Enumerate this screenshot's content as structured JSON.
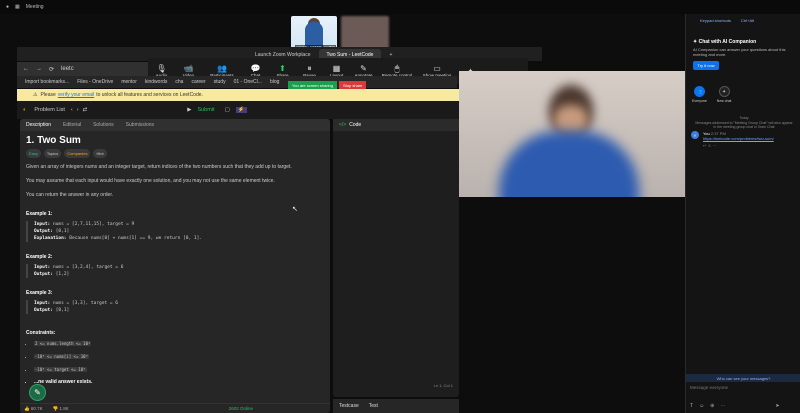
{
  "window": {
    "title": "Meeting"
  },
  "video_strip": {
    "thumb1_name": "AHMATH-JAMMIMI_ALOBJE"
  },
  "browser": {
    "tabs": [
      {
        "label": "Launch Zoom Workplace",
        "active": false
      },
      {
        "label": "Two Sum - LeetCode",
        "active": true
      },
      {
        "label": "+",
        "active": false
      }
    ],
    "address": "leetc",
    "bookmarks": [
      "Import bookmarks...",
      "Files - OneDrive",
      "mentor",
      "kindwords",
      "cha",
      "career",
      "study",
      "01 - OneCl...",
      "blog"
    ]
  },
  "zoom_toolbar": {
    "items": [
      {
        "label": "Audio",
        "icon": "🎙"
      },
      {
        "label": "Video",
        "icon": "📹"
      },
      {
        "label": "Participants",
        "icon": "👥"
      },
      {
        "label": "Chat",
        "icon": "💬"
      },
      {
        "label": "Share",
        "icon": "⬆"
      },
      {
        "label": "Pause",
        "icon": "⏸"
      },
      {
        "label": "Layout",
        "icon": "▦"
      },
      {
        "label": "Annotate",
        "icon": "✎"
      },
      {
        "label": "Remote control",
        "icon": "🖱"
      },
      {
        "label": "Show meeting",
        "icon": "▭"
      },
      {
        "label": "",
        "icon": "✦"
      },
      {
        "label": "",
        "icon": "⋯"
      }
    ],
    "sharing_status": "You are screen sharing",
    "stop_share": "Stop share"
  },
  "banner": {
    "prefix": "Please",
    "link": "verify your email",
    "suffix": "to unlock all features and services on LeetCode."
  },
  "lc_nav": {
    "problem_list": "Problem List",
    "submit": "Submit"
  },
  "problem": {
    "tabs": [
      "Description",
      "Editorial",
      "Solutions",
      "Submissions"
    ],
    "title": "1. Two Sum",
    "chips": [
      "Easy",
      "Topics",
      "Companies",
      "Hint"
    ],
    "p1": "Given an array of integers nums and an integer target, return indices of the two numbers such that they add up to target.",
    "p2": "You may assume that each input would have exactly one solution, and you may not use the same element twice.",
    "p3": "You can return the answer in any order.",
    "examples": [
      {
        "heading": "Example 1:",
        "input": "nums = [2,7,11,15], target = 9",
        "output": "[0,1]",
        "explanation": "Because nums[0] + nums[1] == 9, we return [0, 1]."
      },
      {
        "heading": "Example 2:",
        "input": "nums = [3,2,4], target = 6",
        "output": "[1,2]",
        "explanation": ""
      },
      {
        "heading": "Example 3:",
        "input": "nums = [3,3], target = 6",
        "output": "[0,1]",
        "explanation": ""
      }
    ],
    "constraints_heading": "Constraints:",
    "constraints": [
      "2 <= nums.length <= 10⁴",
      "-10⁹ <= nums[i] <= 10⁹",
      "-10⁹ <= target <= 10⁹",
      "...ne valid answer exists."
    ],
    "footer": {
      "likes": "60.7K",
      "dislikes": "1.8K",
      "online": "2602 Online"
    }
  },
  "code_panel": {
    "tab": "Code",
    "cursor_pos": "Ln 1, Col 1"
  },
  "testcase": {
    "tab1": "Testcase",
    "tab2": "Test"
  },
  "chat_panel": {
    "top_links": [
      "Keypad shortcuts",
      "Ctrl+Alt"
    ],
    "ai_title": "Chat with AI Companion",
    "ai_desc": "AI Companion can answer your questions about this meeting and more.",
    "try_now": "Try it now",
    "to": [
      {
        "label": "Everyone",
        "icon": "👥"
      },
      {
        "label": "New chat",
        "icon": "+"
      }
    ],
    "date_label": "Today",
    "note": "Messages addressed to \"Meeting Group Chat\" will also appear in the meeting group chat in Team Chat",
    "message": {
      "sender": "You",
      "time": "2:37 PM",
      "link": "https://leetcode.com/problems/two-sum/"
    },
    "who_can_see": "Who can see your messages?",
    "input_placeholder": "Message everyone"
  }
}
